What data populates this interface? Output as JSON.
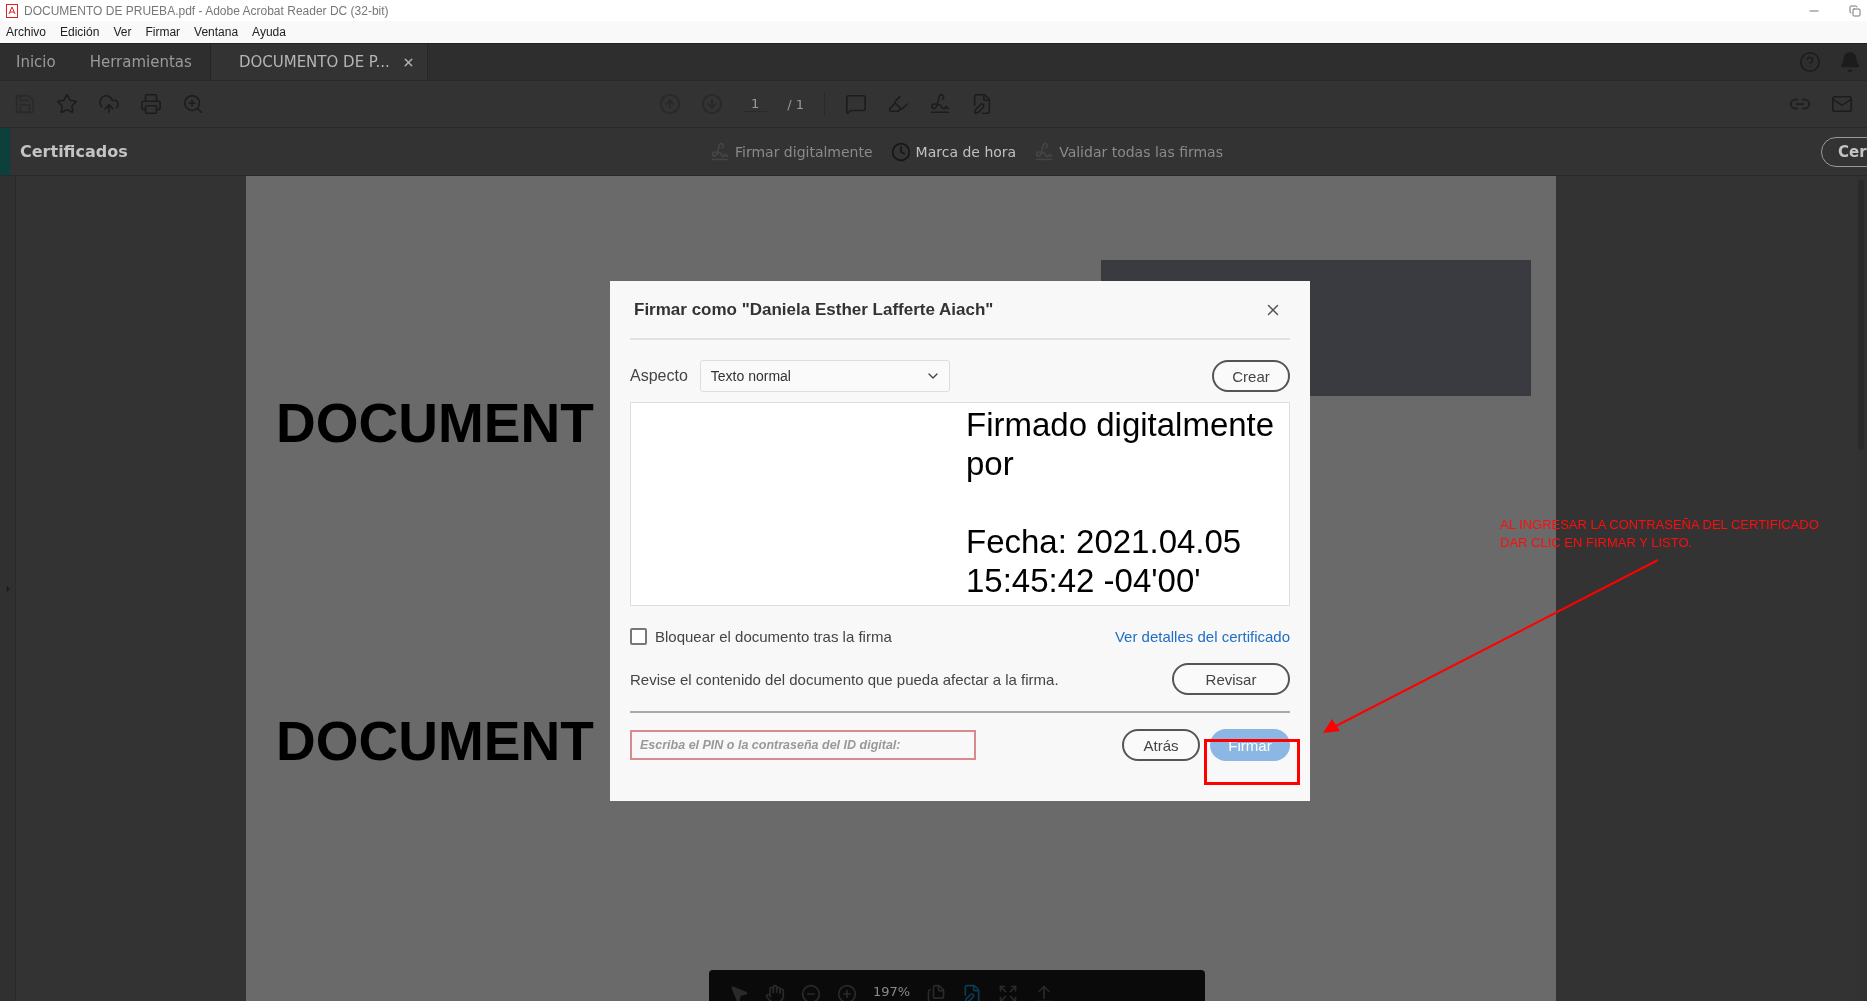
{
  "window": {
    "title": "DOCUMENTO DE PRUEBA.pdf - Adobe Acrobat Reader DC (32-bit)"
  },
  "menu": [
    "Archivo",
    "Edición",
    "Ver",
    "Firmar",
    "Ventana",
    "Ayuda"
  ],
  "tabs": [
    {
      "label": "Inicio",
      "selected": false,
      "closable": false
    },
    {
      "label": "Herramientas",
      "selected": false,
      "closable": false
    },
    {
      "label": "DOCUMENTO DE P...",
      "selected": true,
      "closable": true
    }
  ],
  "page_nav": {
    "current": "1",
    "total": "/ 1"
  },
  "cert_bar": {
    "title": "Certificados",
    "actions": [
      {
        "label": "Firmar digitalmente",
        "disabled": true,
        "kind": "sign"
      },
      {
        "label": "Marca de hora",
        "disabled": false,
        "kind": "timestamp"
      },
      {
        "label": "Validar todas las firmas",
        "disabled": true,
        "kind": "validate"
      }
    ],
    "close_button": "Cer"
  },
  "document": {
    "headings": [
      "DOCUMENT",
      "DOCUMENT"
    ]
  },
  "dialog": {
    "title": "Firmar como \"Daniela Esther Lafferte Aiach\"",
    "appearance_label": "Aspecto",
    "appearance_value": "Texto normal",
    "create_button": "Crear",
    "preview_lines": [
      "Firmado digitalmente por",
      "Fecha: 2021.04.05 15:45:42 -04'00'"
    ],
    "lock_checkbox": {
      "label": "Bloquear el documento tras la firma",
      "checked": false
    },
    "certificate_link": "Ver detalles del certificado",
    "review_text": "Revise el contenido del documento que pueda afectar a la firma.",
    "review_button": "Revisar",
    "pin_field": {
      "placeholder": "Escriba el PIN o la contraseña del ID digital:"
    },
    "back_button": "Atrás",
    "sign_button": {
      "label": "Firmar",
      "disabled": true
    }
  },
  "annotation": {
    "lines": [
      "AL INGRESAR LA CONTRASEÑA DEL CERTIFICADO",
      "DAR CLIC EN FIRMAR Y LISTO."
    ]
  },
  "zoom_toolbar": {
    "zoom": "197%"
  }
}
